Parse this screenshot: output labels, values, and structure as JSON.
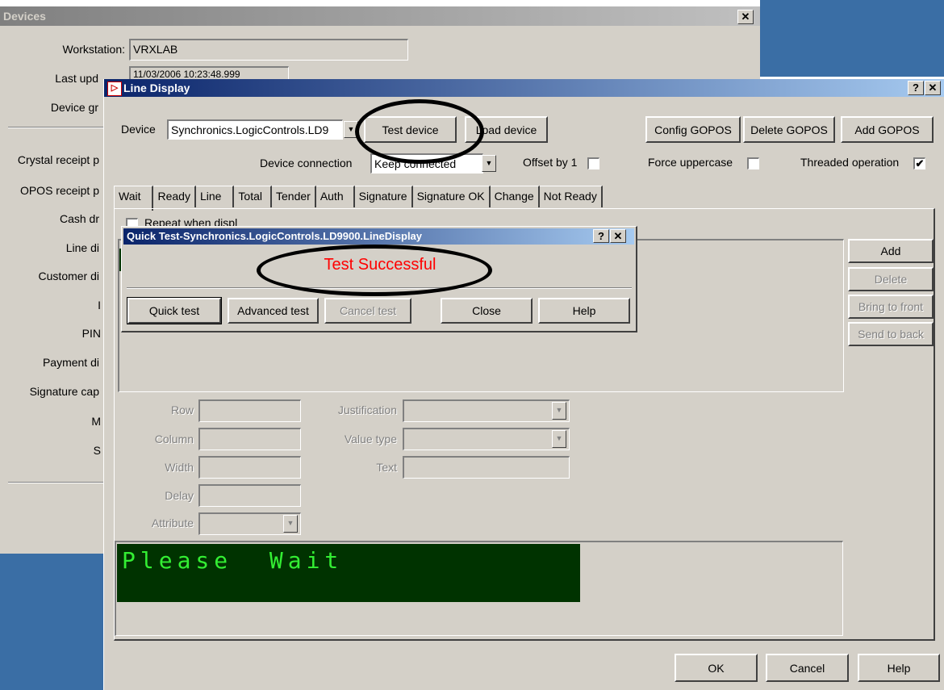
{
  "devices_window": {
    "title": "Devices",
    "workstation_label": "Workstation:",
    "workstation_value": "VRXLAB",
    "last_update_label": "Last upd",
    "last_update_value": "11/03/2006 10:23:48.999",
    "device_group_label": "Device gr",
    "left_items": [
      "Crystal receipt p",
      "OPOS receipt p",
      "Cash dr",
      "Line di",
      "Customer di",
      "I",
      "PIN",
      "Payment di",
      "Signature cap",
      "M",
      "S"
    ]
  },
  "line_display": {
    "title": "Line Display",
    "device_label": "Device",
    "device_value": "Synchronics.LogicControls.LD9",
    "test_device": "Test device",
    "load_device": "Load device",
    "config_gopos": "Config GOPOS",
    "delete_gopos": "Delete GOPOS",
    "add_gopos": "Add GOPOS",
    "device_connection_label": "Device connection",
    "device_connection_value": "Keep connected",
    "offset_label": "Offset by 1",
    "force_upper_label": "Force uppercase",
    "threaded_label": "Threaded operation",
    "threaded_checked": "✔",
    "tabs": [
      "Wait",
      "Ready",
      "Line",
      "Total",
      "Tender",
      "Auth",
      "Signature",
      "Signature OK",
      "Change",
      "Not Ready"
    ],
    "repeat_label": "Repeat when displ",
    "side_buttons": {
      "add": "Add",
      "delete": "Delete",
      "bring_front": "Bring to front",
      "send_back": "Send to back"
    },
    "fields": {
      "row": "Row",
      "column": "Column",
      "width": "Width",
      "delay": "Delay",
      "attribute": "Attribute",
      "justification": "Justification",
      "value_type": "Value type",
      "text": "Text"
    },
    "lcd_text": "Please  Wait",
    "ok": "OK",
    "cancel": "Cancel",
    "help": "Help"
  },
  "quick_test": {
    "title": "Quick Test-Synchronics.LogicControls.LD9900.LineDisplay",
    "message": "Test Successful",
    "message_color": "#ff0000",
    "quick_test": "Quick test",
    "advanced_test": "Advanced test",
    "cancel_test": "Cancel test",
    "close": "Close",
    "help": "Help"
  },
  "colors": {
    "desktop": "#3a6ea5",
    "face": "#d4d0c8",
    "lcd_bg": "#003300",
    "lcd_text": "#33ee33"
  }
}
